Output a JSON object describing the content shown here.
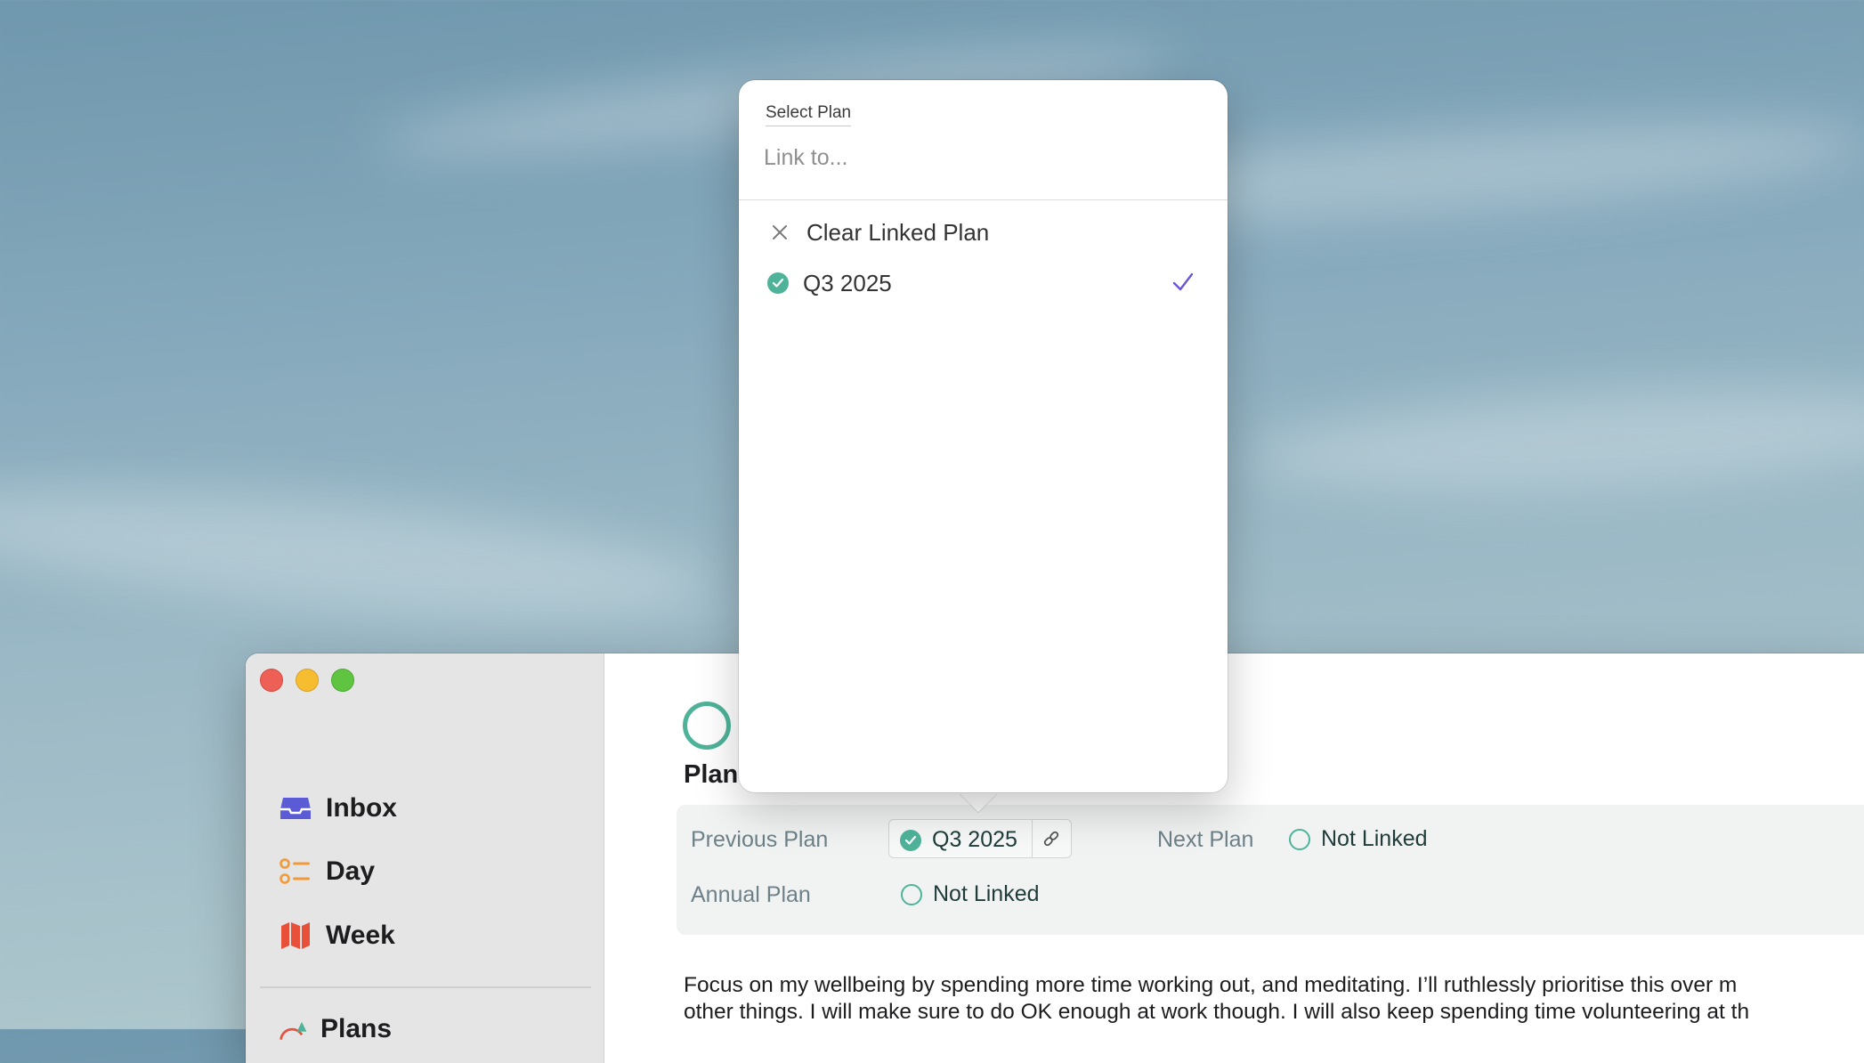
{
  "window": {
    "sidebar": {
      "items": [
        {
          "label": "Inbox",
          "icon": "inbox-icon"
        },
        {
          "label": "Day",
          "icon": "checklist-icon"
        },
        {
          "label": "Week",
          "icon": "map-icon"
        }
      ],
      "partial_item": {
        "label": "Plans",
        "icon": "plans-icon"
      }
    },
    "main": {
      "title": "Plan",
      "links": {
        "previous_plan_label": "Previous Plan",
        "previous_plan_value": "Q3 2025",
        "next_plan_label": "Next Plan",
        "next_plan_value": "Not Linked",
        "annual_plan_label": "Annual Plan",
        "annual_plan_value": "Not Linked"
      },
      "body_line_1": "Focus on my wellbeing by spending more time working out, and meditating. I’ll ruthlessly prioritise this over m",
      "body_line_2": "other things. I will make sure to do OK enough at work though. I will also keep spending time volunteering at th"
    }
  },
  "popover": {
    "title": "Select Plan",
    "search_placeholder": "Link to...",
    "clear_label": "Clear Linked Plan",
    "options": [
      {
        "label": "Q3 2025",
        "selected": true
      }
    ]
  },
  "colors": {
    "accent_green": "#4fb39a",
    "check_purple": "#6b55d6",
    "inbox_purple": "#5b5bd6",
    "day_orange": "#f29a38",
    "week_red": "#e8503a"
  }
}
